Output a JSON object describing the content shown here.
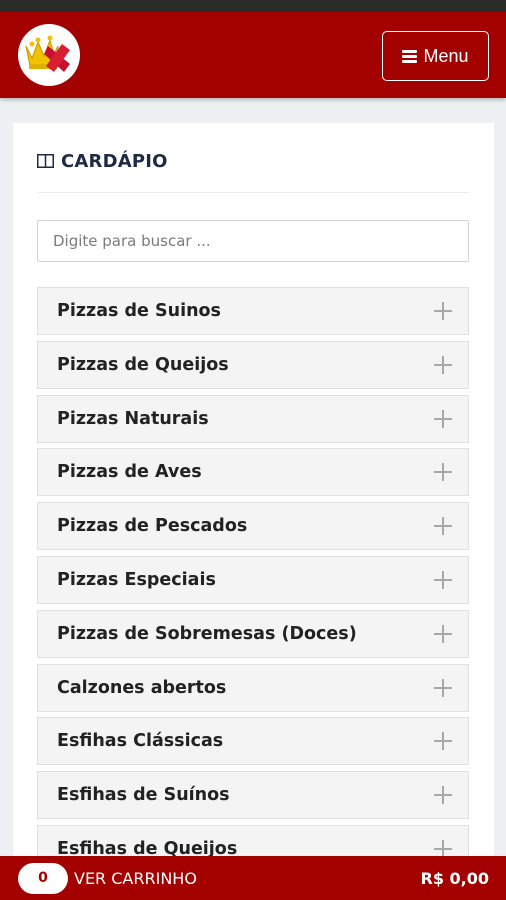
{
  "header": {
    "logo_alt": "logo",
    "menu_label": "Menu"
  },
  "menu_card": {
    "title": "CARDÁPIO",
    "search_placeholder": "Digite para buscar ...",
    "categories": [
      {
        "label": "Pizzas de Suinos"
      },
      {
        "label": "Pizzas de Queijos"
      },
      {
        "label": "Pizzas Naturais"
      },
      {
        "label": "Pizzas de Aves"
      },
      {
        "label": "Pizzas de Pescados"
      },
      {
        "label": "Pizzas Especiais"
      },
      {
        "label": "Pizzas de Sobremesas (Doces)"
      },
      {
        "label": "Calzones abertos"
      },
      {
        "label": "Esfihas Clássicas"
      },
      {
        "label": "Esfihas de Suínos"
      },
      {
        "label": "Esfihas de Queijos"
      }
    ]
  },
  "cart": {
    "count": "0",
    "label": "VER CARRINHO",
    "total": "R$ 0,00"
  },
  "colors": {
    "brand": "#a30000",
    "card_title": "#1f2a44",
    "page_bg": "#eef0f3"
  },
  "icons": [
    "crown-logo-icon",
    "hamburger-icon",
    "book-icon",
    "plus-icon"
  ]
}
